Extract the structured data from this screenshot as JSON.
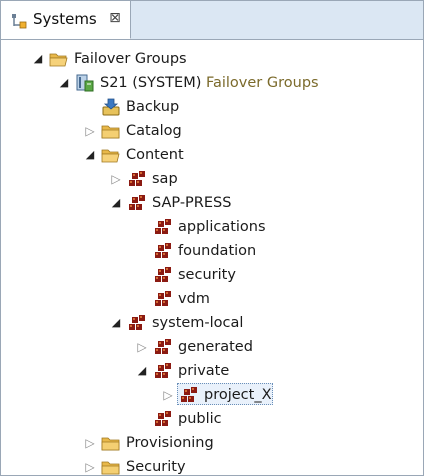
{
  "view": {
    "tab_label": "Systems",
    "close_glyph": "⊠",
    "tab_icon": "systems-view-icon"
  },
  "tree": {
    "nodes": [
      {
        "label": "Failover Groups",
        "icon": "folder-open-icon",
        "expanded": true
      },
      {
        "label": "S21 (SYSTEM)",
        "suffix": "Failover Groups",
        "icon": "system-db-icon",
        "expanded": true
      },
      {
        "label": "Backup",
        "icon": "backup-icon",
        "leaf": true
      },
      {
        "label": "Catalog",
        "icon": "folder-icon",
        "expanded": false
      },
      {
        "label": "Content",
        "icon": "folder-open-icon",
        "expanded": true
      },
      {
        "label": "sap",
        "icon": "package-icon",
        "expanded": false
      },
      {
        "label": "SAP-PRESS",
        "icon": "package-icon",
        "expanded": true
      },
      {
        "label": "applications",
        "icon": "package-icon",
        "leaf": true
      },
      {
        "label": "foundation",
        "icon": "package-icon",
        "leaf": true
      },
      {
        "label": "security",
        "icon": "package-icon",
        "leaf": true
      },
      {
        "label": "vdm",
        "icon": "package-icon",
        "leaf": true
      },
      {
        "label": "system-local",
        "icon": "package-icon",
        "expanded": true
      },
      {
        "label": "generated",
        "icon": "package-icon",
        "expanded": false
      },
      {
        "label": "private",
        "icon": "package-icon",
        "expanded": true
      },
      {
        "label": "project_X",
        "icon": "package-icon",
        "expanded": false,
        "selected": true
      },
      {
        "label": "public",
        "icon": "package-icon",
        "leaf": true
      },
      {
        "label": "Provisioning",
        "icon": "folder-icon",
        "expanded": false
      },
      {
        "label": "Security",
        "icon": "folder-icon",
        "expanded": false
      }
    ]
  },
  "colors": {
    "folder": "#e8b84a",
    "package": "#8b1a12",
    "tab_bar": "#dbe7f3",
    "selection_border": "#6a8fb8",
    "suffix_text": "#7b6a2b"
  }
}
